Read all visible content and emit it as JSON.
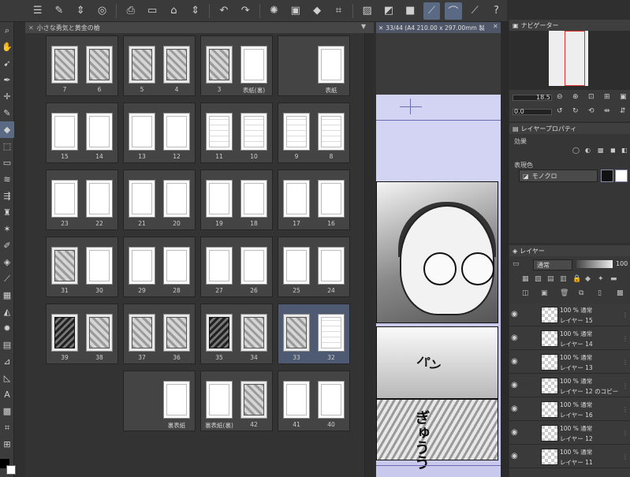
{
  "toolbar": {
    "icons": [
      "menu-icon",
      "new-icon",
      "stepper-icon",
      "save-icon",
      "export-icon",
      "open-icon",
      "print-icon",
      "stepper-icon",
      "undo-icon",
      "redo-icon",
      "loading-icon",
      "clear-icon",
      "fill-icon",
      "transform-icon",
      "ruler-icon",
      "layer-fill-icon",
      "snap-icon",
      "pen-snap-icon",
      "curve-icon",
      "vector-icon",
      "help-icon"
    ]
  },
  "page_manager": {
    "tab_title": "小さな勇気と黄金の槍",
    "rows": [
      [
        {
          "l": "7",
          "r": "6",
          "la": "art",
          "ra": "art"
        },
        {
          "l": "5",
          "r": "4",
          "la": "art",
          "ra": "art"
        },
        {
          "l": "3",
          "r": "表紙(裏)",
          "la": "art",
          "ra": "blank"
        },
        {
          "l": "",
          "r": "表紙",
          "la": "none",
          "ra": "blank"
        }
      ],
      [
        {
          "l": "15",
          "r": "14",
          "la": "blank",
          "ra": "blank"
        },
        {
          "l": "13",
          "r": "12",
          "la": "blank",
          "ra": "blank"
        },
        {
          "l": "11",
          "r": "10",
          "la": "sketch",
          "ra": "sketch"
        },
        {
          "l": "9",
          "r": "8",
          "la": "sketch",
          "ra": "sketch"
        }
      ],
      [
        {
          "l": "23",
          "r": "22",
          "la": "blank",
          "ra": "blank"
        },
        {
          "l": "21",
          "r": "20",
          "la": "blank",
          "ra": "blank"
        },
        {
          "l": "19",
          "r": "18",
          "la": "blank",
          "ra": "blank"
        },
        {
          "l": "17",
          "r": "16",
          "la": "blank",
          "ra": "blank"
        }
      ],
      [
        {
          "l": "31",
          "r": "30",
          "la": "art",
          "ra": "blank"
        },
        {
          "l": "29",
          "r": "28",
          "la": "blank",
          "ra": "blank"
        },
        {
          "l": "27",
          "r": "26",
          "la": "blank",
          "ra": "blank"
        },
        {
          "l": "25",
          "r": "24",
          "la": "blank",
          "ra": "blank"
        }
      ],
      [
        {
          "l": "39",
          "r": "38",
          "la": "dark",
          "ra": "art"
        },
        {
          "l": "37",
          "r": "36",
          "la": "art",
          "ra": "art"
        },
        {
          "l": "35",
          "r": "34",
          "la": "dark",
          "ra": "art"
        },
        {
          "l": "33",
          "r": "32",
          "la": "art",
          "ra": "sketch",
          "sel": true
        }
      ],
      [
        null,
        {
          "l": "",
          "r": "裏表紙",
          "la": "none",
          "ra": "blank"
        },
        {
          "l": "裏表紙(裏)",
          "r": "42",
          "la": "blank",
          "ra": "art"
        },
        {
          "l": "41",
          "r": "40",
          "la": "blank",
          "ra": "blank"
        }
      ]
    ]
  },
  "canvas": {
    "tab_title": "33/44 (A4 210.00 x 297.00mm 製",
    "sfx1": "パン",
    "sfx2": "ぎゅうう"
  },
  "navigator": {
    "tab": "ナビゲーター",
    "zoom": "18.5",
    "rotation": "0.0"
  },
  "layer_property": {
    "tab": "レイヤープロパティ",
    "effect_label": "効果",
    "expression_label": "表現色",
    "expression_value": "モノクロ"
  },
  "layers": {
    "tab": "レイヤー",
    "blend_mode": "通常",
    "opacity": "100",
    "items": [
      {
        "top": "100 % 通常",
        "name": "レイヤー 15"
      },
      {
        "top": "100 % 通常",
        "name": "レイヤー 14"
      },
      {
        "top": "100 % 通常",
        "name": "レイヤー 13"
      },
      {
        "top": "100 % 通常",
        "name": "レイヤー 12 のコピー"
      },
      {
        "top": "100 % 通常",
        "name": "レイヤー 16"
      },
      {
        "top": "100 % 通常",
        "name": "レイヤー 12"
      },
      {
        "top": "100 % 通常",
        "name": "レイヤー 11"
      }
    ]
  },
  "colors": {
    "accent": "#5a6a85",
    "canvas_margin": "#c9c9ee",
    "panel_bg": "#333333"
  }
}
